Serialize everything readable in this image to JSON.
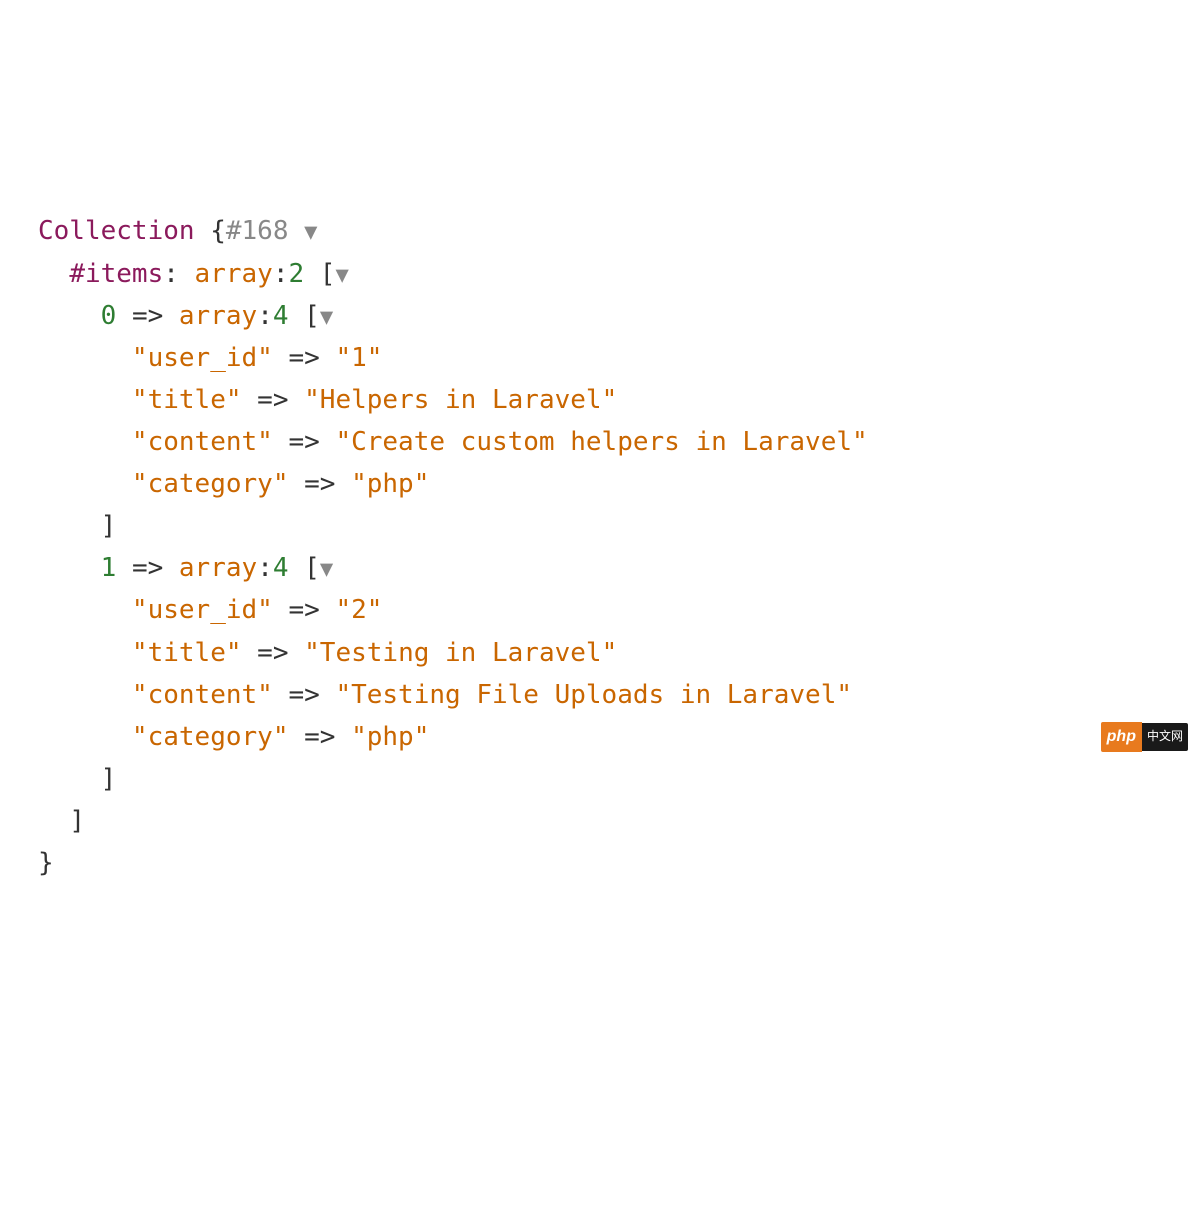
{
  "dump": {
    "class_name": "Collection",
    "object_id": "#168",
    "caret": "▼",
    "items_prop": "#items",
    "colon": ":",
    "array_label": "array",
    "items_count": "2",
    "open_brace": "{",
    "close_brace": "}",
    "open_bracket": "[",
    "close_bracket": "]",
    "arrow": "=>",
    "entries": [
      {
        "index": "0",
        "count": "4",
        "fields": [
          {
            "key": "user_id",
            "value": "1"
          },
          {
            "key": "title",
            "value": "Helpers in Laravel"
          },
          {
            "key": "content",
            "value": "Create custom helpers in Laravel"
          },
          {
            "key": "category",
            "value": "php"
          }
        ]
      },
      {
        "index": "1",
        "count": "4",
        "fields": [
          {
            "key": "user_id",
            "value": "2"
          },
          {
            "key": "title",
            "value": "Testing in Laravel"
          },
          {
            "key": "content",
            "value": "Testing File Uploads in Laravel"
          },
          {
            "key": "category",
            "value": "php"
          }
        ]
      }
    ]
  },
  "badge": {
    "php": "php",
    "cn": "中文网"
  }
}
